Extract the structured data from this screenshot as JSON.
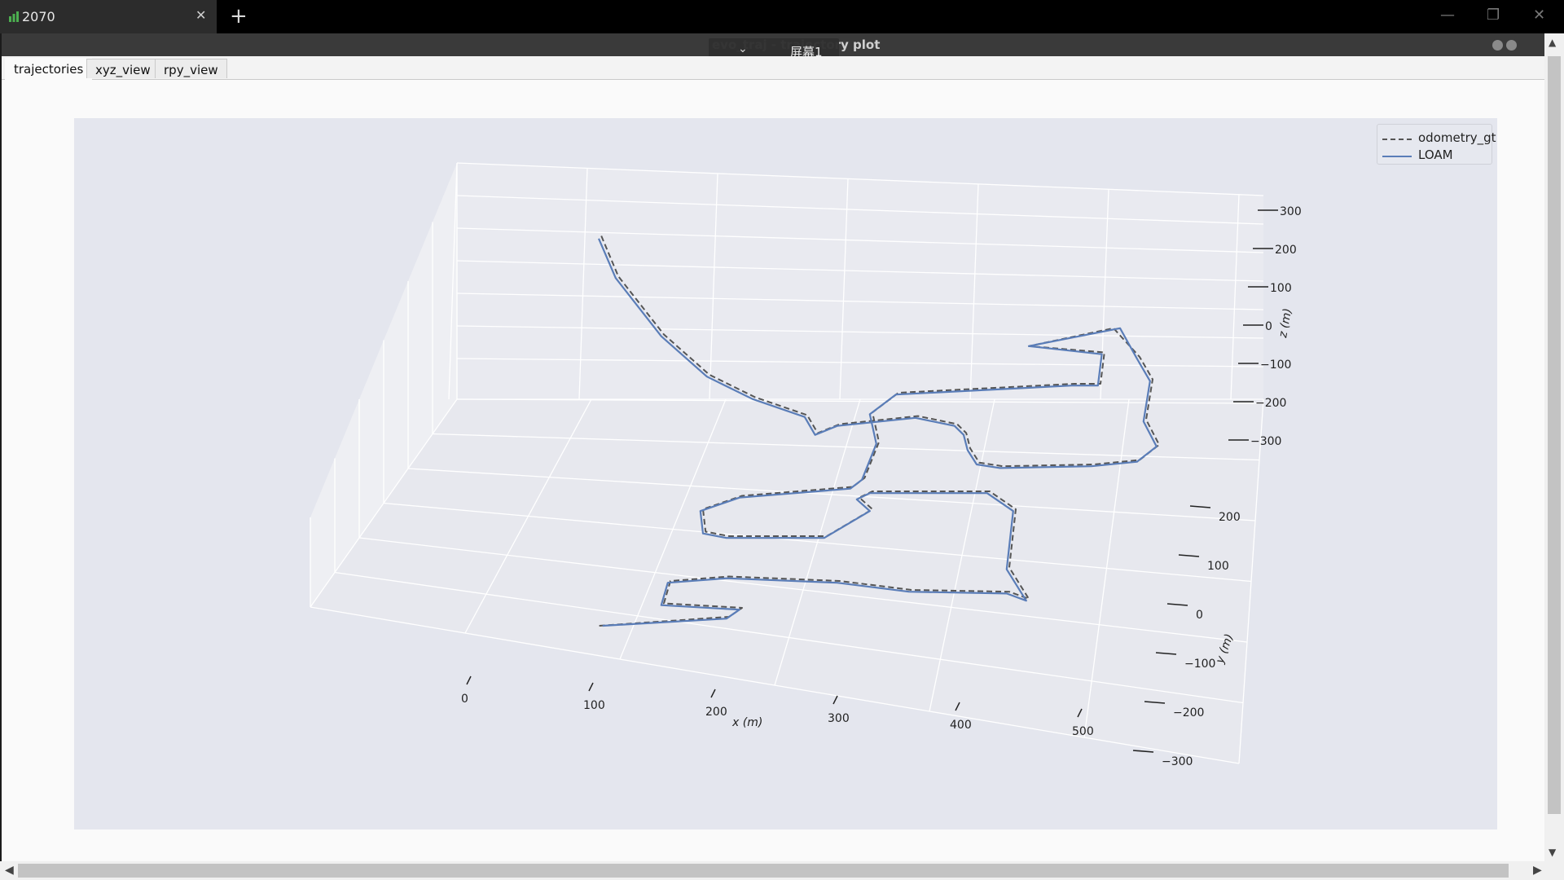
{
  "browser_tab": {
    "title": "2070",
    "close": "✕",
    "new_tab": "+"
  },
  "window_controls": {
    "minimize": "—",
    "maximize": "❐",
    "close": "✕"
  },
  "inner_window": {
    "caption": "evo_traj - trajectory plot",
    "overlay_label": "屏幕1",
    "overlay_chevron": "⌄"
  },
  "tabs": [
    "trajectories",
    "xyz_view",
    "rpy_view"
  ],
  "active_tab": "trajectories",
  "colors": {
    "gt": "#555555",
    "loam": "#5a7db8",
    "pane": "#e4e6ee"
  },
  "chart_data": {
    "type": "line",
    "projection": "3d",
    "xlabel": "x (m)",
    "ylabel": "y (m)",
    "zlabel": "z (m)",
    "x_ticks": [
      "0",
      "100",
      "200",
      "300",
      "400",
      "500"
    ],
    "y_ticks": [
      "200",
      "100",
      "0",
      "−100",
      "−200",
      "−300"
    ],
    "z_ticks": [
      "300",
      "200",
      "100",
      "0",
      "−100",
      "−200",
      "−300"
    ],
    "xlim": [
      -90,
      590
    ],
    "ylim": [
      -320,
      260
    ],
    "zlim": [
      -320,
      330
    ],
    "grid": true,
    "legend_position": "top-right",
    "series": [
      {
        "name": "odometry_gt",
        "style": "dashed",
        "points": [
          [
            92,
            -5
          ],
          [
            105,
            40
          ],
          [
            140,
            105
          ],
          [
            175,
            150
          ],
          [
            210,
            175
          ],
          [
            250,
            195
          ],
          [
            258,
            215
          ],
          [
            275,
            205
          ],
          [
            335,
            196
          ],
          [
            365,
            205
          ],
          [
            372,
            215
          ],
          [
            375,
            232
          ],
          [
            382,
            248
          ],
          [
            400,
            252
          ],
          [
            470,
            250
          ],
          [
            505,
            245
          ],
          [
            520,
            228
          ],
          [
            510,
            200
          ],
          [
            515,
            155
          ],
          [
            505,
            130
          ],
          [
            485,
            98
          ],
          [
            420,
            118
          ],
          [
            478,
            125
          ],
          [
            475,
            160
          ],
          [
            455,
            160
          ],
          [
            320,
            170
          ],
          [
            300,
            192
          ],
          [
            305,
            225
          ],
          [
            294,
            265
          ],
          [
            285,
            275
          ],
          [
            200,
            285
          ],
          [
            170,
            300
          ],
          [
            172,
            325
          ],
          [
            190,
            330
          ],
          [
            265,
            330
          ],
          [
            300,
            300
          ],
          [
            290,
            287
          ],
          [
            300,
            280
          ],
          [
            390,
            280
          ],
          [
            410,
            300
          ],
          [
            405,
            365
          ],
          [
            420,
            400
          ],
          [
            405,
            392
          ],
          [
            330,
            390
          ],
          [
            275,
            380
          ],
          [
            190,
            375
          ],
          [
            145,
            380
          ],
          [
            140,
            405
          ],
          [
            200,
            410
          ],
          [
            190,
            420
          ],
          [
            90,
            430
          ]
        ]
      },
      {
        "name": "LOAM",
        "style": "solid",
        "points": [
          [
            90,
            -2
          ],
          [
            103,
            42
          ],
          [
            138,
            107
          ],
          [
            173,
            152
          ],
          [
            208,
            177
          ],
          [
            248,
            197
          ],
          [
            256,
            217
          ],
          [
            273,
            207
          ],
          [
            333,
            198
          ],
          [
            363,
            207
          ],
          [
            370,
            217
          ],
          [
            373,
            234
          ],
          [
            380,
            250
          ],
          [
            398,
            254
          ],
          [
            468,
            252
          ],
          [
            503,
            247
          ],
          [
            518,
            230
          ],
          [
            508,
            202
          ],
          [
            513,
            157
          ],
          [
            503,
            132
          ],
          [
            490,
            98
          ],
          [
            420,
            118
          ],
          [
            476,
            127
          ],
          [
            473,
            162
          ],
          [
            453,
            162
          ],
          [
            318,
            172
          ],
          [
            298,
            194
          ],
          [
            303,
            227
          ],
          [
            292,
            267
          ],
          [
            283,
            277
          ],
          [
            198,
            287
          ],
          [
            168,
            302
          ],
          [
            170,
            327
          ],
          [
            188,
            332
          ],
          [
            263,
            332
          ],
          [
            298,
            302
          ],
          [
            288,
            289
          ],
          [
            298,
            282
          ],
          [
            388,
            282
          ],
          [
            408,
            302
          ],
          [
            403,
            367
          ],
          [
            418,
            402
          ],
          [
            403,
            394
          ],
          [
            328,
            392
          ],
          [
            273,
            382
          ],
          [
            188,
            377
          ],
          [
            143,
            382
          ],
          [
            138,
            407
          ],
          [
            198,
            412
          ],
          [
            188,
            422
          ],
          [
            93,
            430
          ]
        ]
      }
    ]
  }
}
